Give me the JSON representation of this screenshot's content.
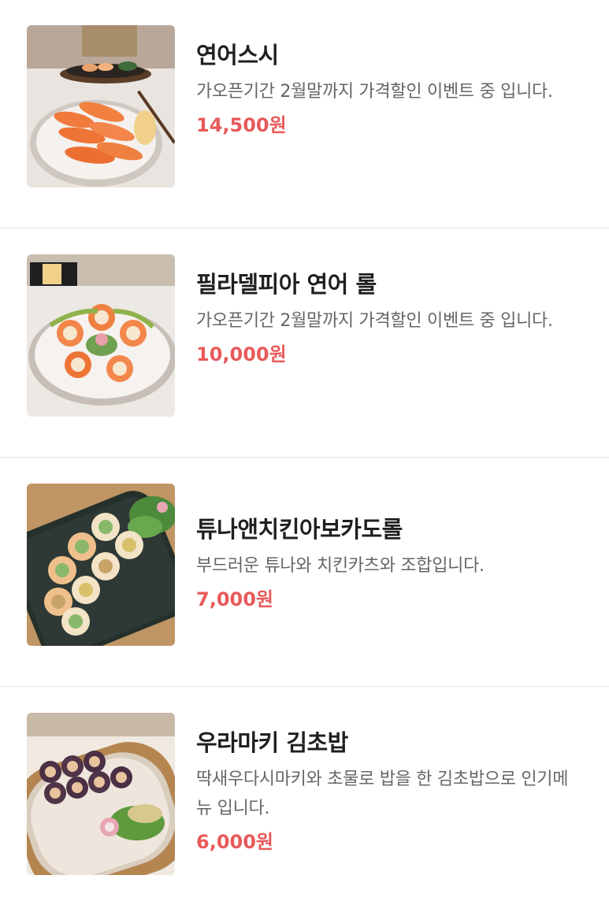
{
  "menu": {
    "items": [
      {
        "name": "연어스시",
        "description": "가오픈기간 2월말까지 가격할인 이벤트 중 입니다.",
        "price": "14,500원",
        "image_icon": "salmon-sushi-photo"
      },
      {
        "name": "필라델피아 연어 롤",
        "description": "가오픈기간 2월말까지 가격할인 이벤트 중 입니다.",
        "price": "10,000원",
        "image_icon": "philadelphia-roll-photo"
      },
      {
        "name": "튜나앤치킨아보카도롤",
        "description": "부드러운 튜나와 치킨카츠와 조합입니다.",
        "price": "7,000원",
        "image_icon": "tuna-chicken-roll-photo"
      },
      {
        "name": "우라마키 김초밥",
        "description": "딱새우다시마키와 초물로 밥을 한 김초밥으로 인기메뉴 입니다.",
        "price": "6,000원",
        "image_icon": "uramaki-kimbap-photo"
      }
    ]
  },
  "colors": {
    "price": "#e85a5a",
    "name": "#1f1f1f",
    "description": "#666666",
    "divider": "#e6e6e6"
  }
}
